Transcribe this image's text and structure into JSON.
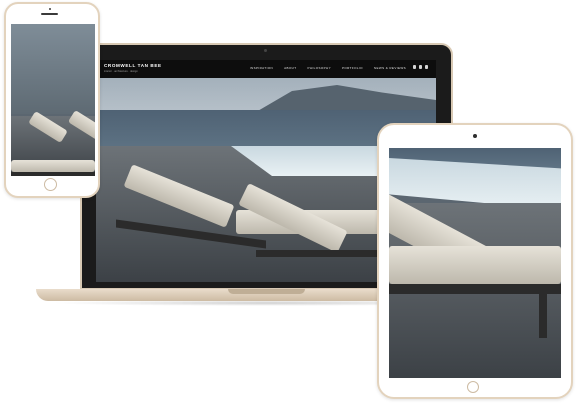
{
  "website": {
    "brand": "CROMWELL TAN BEE",
    "tagline": "interior · architecture · design",
    "menu": [
      "INSPIRATION",
      "ABOUT",
      "PHILOSOPHY",
      "PORTFOLIO",
      "NEWS & REVIEWS"
    ],
    "social_icons": [
      "facebook-icon",
      "instagram-icon",
      "pinterest-icon"
    ]
  },
  "devices": [
    "phone",
    "laptop",
    "tablet"
  ],
  "colors": {
    "device_gold": "#e3d3bd",
    "screen_bezel": "#1b1b1b",
    "nav_bar": "#0d0d0d"
  }
}
